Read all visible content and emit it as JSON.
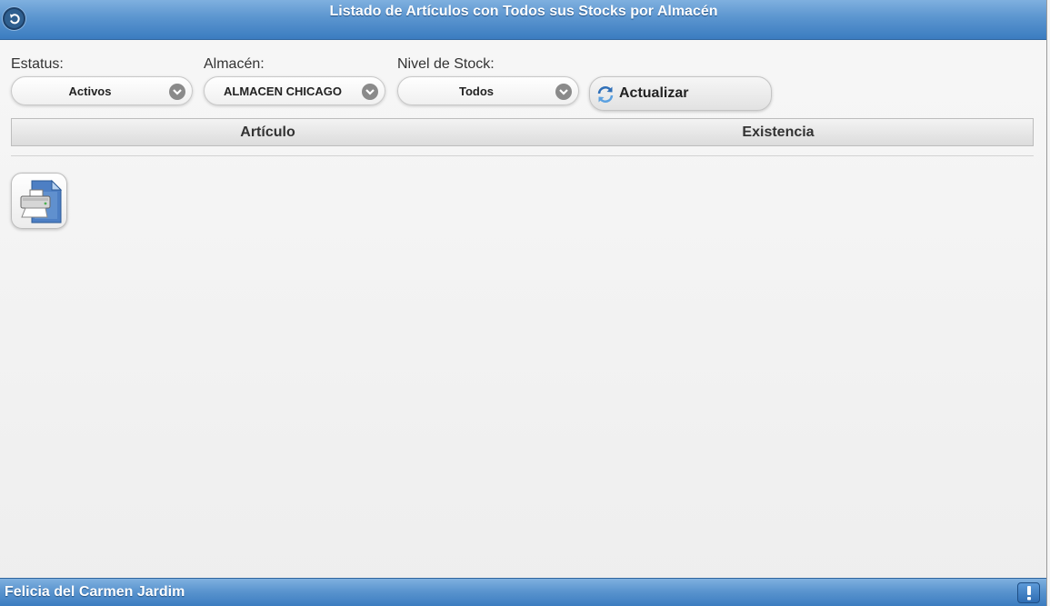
{
  "header": {
    "title": "Listado de Artículos con Todos sus Stocks por Almacén",
    "back_icon": "back-arrow-icon"
  },
  "filters": {
    "status": {
      "label": "Estatus:",
      "selected": "Activos"
    },
    "warehouse": {
      "label": "Almacén:",
      "selected": "ALMACEN CHICAGO"
    },
    "stock_level": {
      "label": "Nivel de Stock:",
      "selected": "Todos"
    }
  },
  "refresh_button": {
    "label": "Actualizar",
    "icon": "refresh-icon"
  },
  "table": {
    "columns": [
      "Artículo",
      "Existencia"
    ],
    "rows": []
  },
  "print_button": {
    "icon": "printer-icon"
  },
  "footer": {
    "user": "Felicia del Carmen Jardim",
    "alert_icon": "exclamation-icon"
  },
  "colors": {
    "header_blue": "#5b95cf",
    "background": "#f5f5f5"
  }
}
